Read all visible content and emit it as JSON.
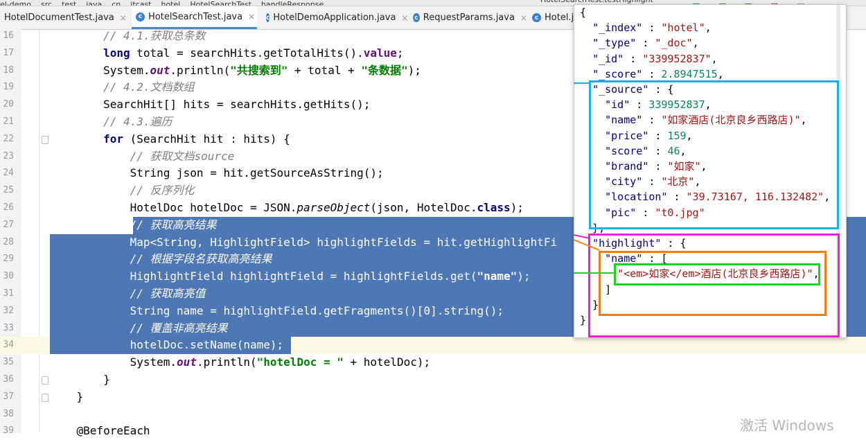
{
  "breadcrumb": [
    "el-demo",
    "src",
    "test",
    "java",
    "cn",
    "itcast",
    "hotel",
    "HotelSearchTest",
    "handleResponse"
  ],
  "run_config": "HotelSearchTest.testHighlight",
  "tabs": [
    {
      "label": "HotelDocumentTest.java",
      "active": false,
      "icon": "class-icon"
    },
    {
      "label": "HotelSearchTest.java",
      "active": true,
      "icon": "class-icon"
    },
    {
      "label": "HotelDemoApplication.java",
      "active": false,
      "icon": "class-icon"
    },
    {
      "label": "RequestParams.java",
      "active": false,
      "icon": "class-icon"
    },
    {
      "label": "Hotel.ja",
      "active": false,
      "icon": "class-icon"
    }
  ],
  "editor": {
    "lines": [
      {
        "n": "16",
        "tokens": [
          [
            "cm",
            "        // 4.1.获取总条数"
          ]
        ]
      },
      {
        "n": "17",
        "tokens": [
          [
            "",
            "        "
          ],
          [
            "kw",
            "long"
          ],
          [
            "",
            " total = searchHits.getTotalHits()."
          ],
          [
            "fldp",
            "value"
          ],
          [
            "",
            ";"
          ]
        ]
      },
      {
        "n": "18",
        "tokens": [
          [
            "",
            "        System."
          ],
          [
            "fld",
            "out"
          ],
          [
            "",
            ".println("
          ],
          [
            "str",
            "\"共搜索到\""
          ],
          [
            "",
            " + total + "
          ],
          [
            "str",
            "\"条数据\""
          ],
          [
            "",
            ");"
          ]
        ]
      },
      {
        "n": "19",
        "tokens": [
          [
            "cm",
            "        // 4.2.文档数组"
          ]
        ]
      },
      {
        "n": "20",
        "tokens": [
          [
            "",
            "        SearchHit[] hits = searchHits.getHits();"
          ]
        ]
      },
      {
        "n": "21",
        "tokens": [
          [
            "cm",
            "        // 4.3.遍历"
          ]
        ]
      },
      {
        "n": "22",
        "tokens": [
          [
            "",
            "        "
          ],
          [
            "kw",
            "for"
          ],
          [
            "",
            " (SearchHit hit : hits) {"
          ]
        ]
      },
      {
        "n": "23",
        "tokens": [
          [
            "cm",
            "            // 获取文档source"
          ]
        ]
      },
      {
        "n": "24",
        "tokens": [
          [
            "",
            "            String json = hit.getSourceAsString();"
          ]
        ]
      },
      {
        "n": "25",
        "tokens": [
          [
            "cm",
            "            // 反序列化"
          ]
        ]
      },
      {
        "n": "26",
        "tokens": [
          [
            "",
            "            HotelDoc hotelDoc = JSON."
          ],
          [
            "mth",
            "parseObject"
          ],
          [
            "",
            "(json, HotelDoc."
          ],
          [
            "kw",
            "class"
          ],
          [
            "",
            ");"
          ]
        ]
      },
      {
        "n": "27",
        "tokens": [
          [
            "cm",
            "            // 获取高亮结果"
          ]
        ]
      },
      {
        "n": "28",
        "tokens": [
          [
            "",
            "            Map<String, HighlightField> highlightFields = hit.getHighlightFi"
          ]
        ]
      },
      {
        "n": "29",
        "tokens": [
          [
            "cm",
            "            // 根据字段名获取高亮结果"
          ]
        ]
      },
      {
        "n": "30",
        "tokens": [
          [
            "",
            "            HighlightField highlightField = highlightFields.get("
          ],
          [
            "str",
            "\"name\""
          ],
          [
            "",
            ");"
          ]
        ]
      },
      {
        "n": "31",
        "tokens": [
          [
            "cm",
            "            // 获取高亮值"
          ]
        ]
      },
      {
        "n": "32",
        "tokens": [
          [
            "",
            "            String name = highlightField.getFragments()[0].string();"
          ]
        ]
      },
      {
        "n": "33",
        "tokens": [
          [
            "cm",
            "            // 覆盖非高亮结果"
          ]
        ]
      },
      {
        "n": "34",
        "tokens": [
          [
            "",
            "            hotelDoc.setName(name);"
          ]
        ]
      },
      {
        "n": "35",
        "tokens": [
          [
            "",
            "            System."
          ],
          [
            "fld",
            "out"
          ],
          [
            "",
            ".println("
          ],
          [
            "str",
            "\"hotelDoc = \""
          ],
          [
            "",
            " + hotelDoc);"
          ]
        ]
      },
      {
        "n": "36",
        "tokens": [
          [
            "",
            "        }"
          ]
        ]
      },
      {
        "n": "37",
        "tokens": [
          [
            "",
            "    }"
          ]
        ]
      },
      {
        "n": "38",
        "tokens": [
          [
            "",
            ""
          ]
        ]
      },
      {
        "n": "39",
        "tokens": [
          [
            "",
            "    @BeforeEach"
          ]
        ]
      }
    ]
  },
  "json_popup": {
    "lines": [
      [
        [
          "",
          "{"
        ]
      ],
      [
        [
          "",
          "  "
        ],
        [
          "pk",
          "\"_index\""
        ],
        [
          "",
          " : "
        ],
        [
          "ps",
          "\"hotel\""
        ],
        [
          "",
          ","
        ]
      ],
      [
        [
          "",
          "  "
        ],
        [
          "pk",
          "\"_type\""
        ],
        [
          "",
          " : "
        ],
        [
          "ps",
          "\"_doc\""
        ],
        [
          "",
          ","
        ]
      ],
      [
        [
          "",
          "  "
        ],
        [
          "pk",
          "\"_id\""
        ],
        [
          "",
          " : "
        ],
        [
          "ps",
          "\"339952837\""
        ],
        [
          "",
          ","
        ]
      ],
      [
        [
          "",
          "  "
        ],
        [
          "pk",
          "\"_score\""
        ],
        [
          "",
          " : "
        ],
        [
          "pn",
          "2.8947515"
        ],
        [
          "",
          ","
        ]
      ],
      [
        [
          "",
          "  "
        ],
        [
          "pk",
          "\"_source\""
        ],
        [
          "",
          " : {"
        ]
      ],
      [
        [
          "",
          "    "
        ],
        [
          "pk",
          "\"id\""
        ],
        [
          "",
          " : "
        ],
        [
          "pn",
          "339952837"
        ],
        [
          "",
          ","
        ]
      ],
      [
        [
          "",
          "    "
        ],
        [
          "pk",
          "\"name\""
        ],
        [
          "",
          " : "
        ],
        [
          "ps",
          "\"如家酒店(北京良乡西路店)\""
        ],
        [
          "",
          ","
        ]
      ],
      [
        [
          "",
          "    "
        ],
        [
          "pk",
          "\"price\""
        ],
        [
          "",
          " : "
        ],
        [
          "pn",
          "159"
        ],
        [
          "",
          ","
        ]
      ],
      [
        [
          "",
          "    "
        ],
        [
          "pk",
          "\"score\""
        ],
        [
          "",
          " : "
        ],
        [
          "pn",
          "46"
        ],
        [
          "",
          ","
        ]
      ],
      [
        [
          "",
          "    "
        ],
        [
          "pk",
          "\"brand\""
        ],
        [
          "",
          " : "
        ],
        [
          "ps",
          "\"如家\""
        ],
        [
          "",
          ","
        ]
      ],
      [
        [
          "",
          "    "
        ],
        [
          "pk",
          "\"city\""
        ],
        [
          "",
          " : "
        ],
        [
          "ps",
          "\"北京\""
        ],
        [
          "",
          ","
        ]
      ],
      [
        [
          "",
          "    "
        ],
        [
          "pk",
          "\"location\""
        ],
        [
          "",
          " : "
        ],
        [
          "ps",
          "\"39.73167, 116.132482\""
        ],
        [
          "",
          ","
        ]
      ],
      [
        [
          "",
          "    "
        ],
        [
          "pk",
          "\"pic\""
        ],
        [
          "",
          " : "
        ],
        [
          "ps",
          "\"t0.jpg\""
        ]
      ],
      [
        [
          "",
          "  },"
        ]
      ],
      [
        [
          "",
          "  "
        ],
        [
          "pk",
          "\"highlight\""
        ],
        [
          "",
          " : {"
        ]
      ],
      [
        [
          "",
          "    "
        ],
        [
          "pk",
          "\"name\""
        ],
        [
          "",
          " : ["
        ]
      ],
      [
        [
          "",
          "      "
        ],
        [
          "ps",
          "\"<em>如家</em>酒店(北京良乡西路店)\""
        ],
        [
          "",
          ","
        ]
      ],
      [
        [
          "",
          "    ]"
        ]
      ],
      [
        [
          "",
          "  }"
        ]
      ],
      [
        [
          "",
          "}"
        ]
      ]
    ]
  },
  "watermark": "激活 Windows",
  "colors": {
    "source_box": "#1ab0e8",
    "highlight_box": "#e621d8",
    "name_box": "#f07f12",
    "em_box": "#1fd11f",
    "selection": "#2f5fa8"
  }
}
